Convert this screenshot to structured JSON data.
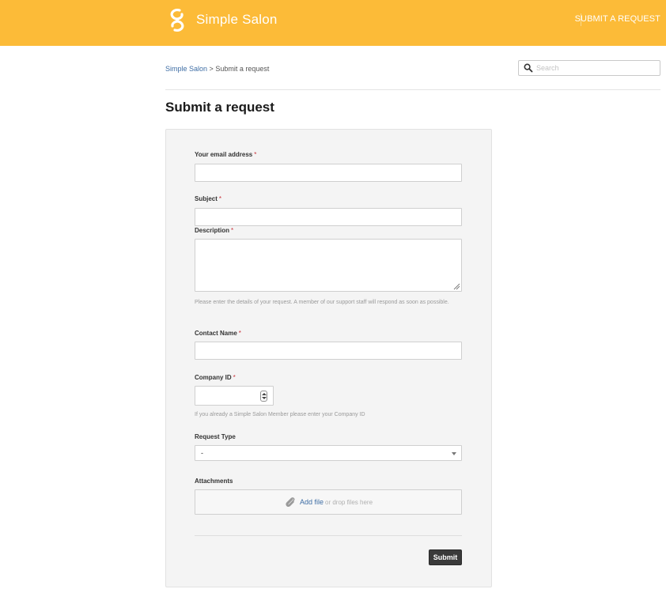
{
  "header": {
    "brand": "Simple Salon",
    "nav_link": "SUBMIT A REQUEST",
    "background_color": "#fcbb38"
  },
  "breadcrumb": {
    "root": "Simple Salon",
    "separator": ">",
    "current": "Submit a request"
  },
  "search": {
    "placeholder": "Search",
    "icon": "search-icon"
  },
  "page": {
    "title": "Submit a request"
  },
  "form": {
    "email": {
      "label": "Your email address",
      "required_mark": "*",
      "value": ""
    },
    "subject": {
      "label": "Subject",
      "required_mark": "*",
      "value": ""
    },
    "description": {
      "label": "Description",
      "required_mark": "*",
      "value": "",
      "hint": "Please enter the details of your request. A member of our support staff will respond as soon as possible."
    },
    "contact_name": {
      "label": "Contact Name",
      "required_mark": "*",
      "value": ""
    },
    "company_id": {
      "label": "Company ID",
      "required_mark": "*",
      "value": "",
      "hint": "If you already a Simple Salon Member please enter your Company ID"
    },
    "request_type": {
      "label": "Request Type",
      "selected": "-"
    },
    "attachments": {
      "label": "Attachments",
      "add_file": "Add file",
      "drop_text": "or drop files here",
      "icon": "paperclip-icon"
    },
    "submit_label": "Submit"
  },
  "colors": {
    "accent": "#fcbb38",
    "link": "#3f6ea5",
    "required": "#c8323a",
    "button": "#3a3a3a"
  }
}
